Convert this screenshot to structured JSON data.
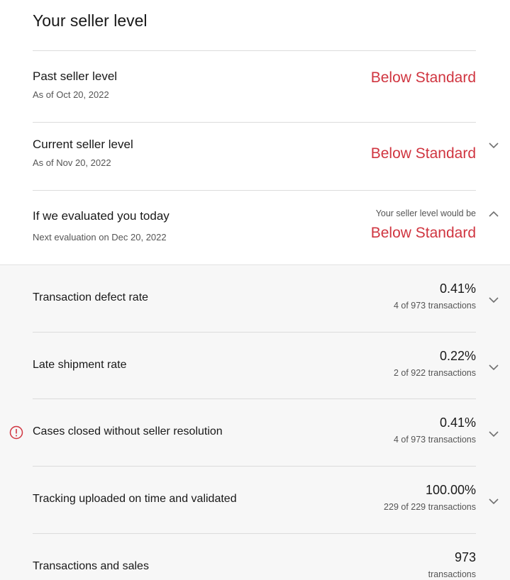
{
  "page_title": "Your seller level",
  "past_level": {
    "title": "Past seller level",
    "subtitle": "As of Oct 20, 2022",
    "status": "Below Standard"
  },
  "current_level": {
    "title": "Current seller level",
    "subtitle": "As of Nov 20, 2022",
    "status": "Below Standard"
  },
  "evaluated_today": {
    "title": "If we evaluated you today",
    "subtitle": "Next evaluation on Dec 20, 2022",
    "note": "Your seller level would be",
    "status": "Below Standard"
  },
  "metrics": [
    {
      "label": "Transaction defect rate",
      "value": "0.41%",
      "detail": "4 of 973 transactions",
      "alert": false
    },
    {
      "label": "Late shipment rate",
      "value": "0.22%",
      "detail": "2 of 922 transactions",
      "alert": false
    },
    {
      "label": "Cases closed without seller resolution",
      "value": "0.41%",
      "detail": "4 of 973 transactions",
      "alert": true
    },
    {
      "label": "Tracking uploaded on time and validated",
      "value": "100.00%",
      "detail": "229 of 229 transactions",
      "alert": false
    },
    {
      "label": "Transactions and sales",
      "value": "973",
      "detail": "transactions",
      "alert": false
    }
  ],
  "icons": {
    "expand": "chevron-down-icon",
    "collapse": "chevron-up-icon",
    "alert": "alert-circle-icon"
  },
  "colors": {
    "status_red": "#d03540",
    "alert_red": "#d03540",
    "panel_gray": "#f7f7f7"
  }
}
